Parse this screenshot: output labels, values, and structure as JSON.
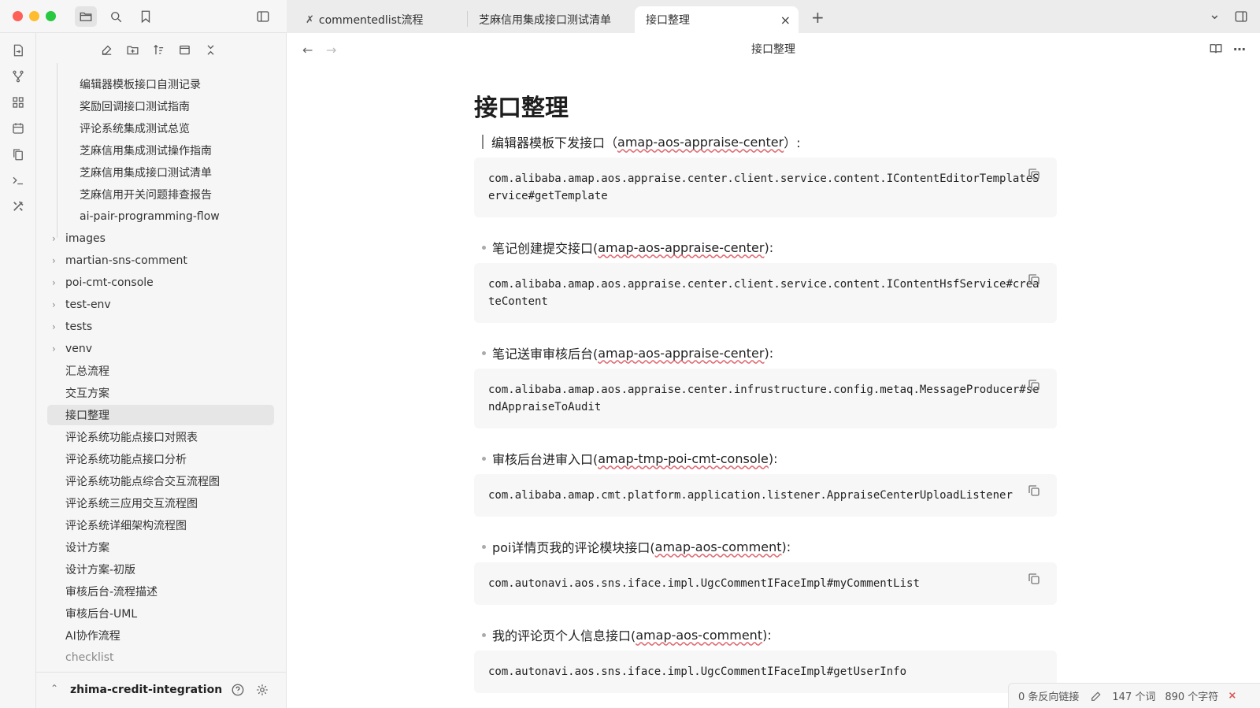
{
  "tabs": [
    {
      "label": "commentedlist流程",
      "icon": "tool-icon"
    },
    {
      "label": "芝麻信用集成接口测试清单"
    },
    {
      "label": "接口整理",
      "active": true
    }
  ],
  "tabbar": {
    "new_tab": "+",
    "close": "×",
    "more": "⌄"
  },
  "sidebar": {
    "tree": [
      {
        "label": "编辑器模板接口自测记录",
        "level": 2
      },
      {
        "label": "奖励回调接口测试指南",
        "level": 2
      },
      {
        "label": "评论系统集成测试总览",
        "level": 2
      },
      {
        "label": "芝麻信用集成测试操作指南",
        "level": 2
      },
      {
        "label": "芝麻信用集成接口测试清单",
        "level": 2
      },
      {
        "label": "芝麻信用开关问题排查报告",
        "level": 2
      },
      {
        "label": "ai-pair-programming-flow",
        "level": 2
      },
      {
        "label": "images",
        "level": 1,
        "folder": true
      },
      {
        "label": "martian-sns-comment",
        "level": 1,
        "folder": true
      },
      {
        "label": "poi-cmt-console",
        "level": 1,
        "folder": true
      },
      {
        "label": "test-env",
        "level": 1,
        "folder": true
      },
      {
        "label": "tests",
        "level": 1,
        "folder": true
      },
      {
        "label": "venv",
        "level": 1,
        "folder": true
      },
      {
        "label": "汇总流程",
        "level": 1
      },
      {
        "label": "交互方案",
        "level": 1
      },
      {
        "label": "接口整理",
        "level": 1,
        "active": true
      },
      {
        "label": "评论系统功能点接口对照表",
        "level": 1
      },
      {
        "label": "评论系统功能点接口分析",
        "level": 1
      },
      {
        "label": "评论系统功能点综合交互流程图",
        "level": 1
      },
      {
        "label": "评论系统三应用交互流程图",
        "level": 1
      },
      {
        "label": "评论系统详细架构流程图",
        "level": 1
      },
      {
        "label": "设计方案",
        "level": 1
      },
      {
        "label": "设计方案-初版",
        "level": 1
      },
      {
        "label": "审核后台-流程描述",
        "level": 1
      },
      {
        "label": "审核后台-UML",
        "level": 1
      },
      {
        "label": "AI协作流程",
        "level": 1
      },
      {
        "label": "checklist",
        "level": 1
      }
    ],
    "vault_name": "zhima-credit-integration",
    "folder_chevron": "›",
    "vault_chevron": "⌃"
  },
  "editor": {
    "back": "←",
    "forward": "→",
    "doc_title": "接口整理",
    "h1": "接口整理",
    "entries": [
      {
        "prefix": "编辑器模板下发接口（",
        "service": "amap-aos-appraise-center",
        "suffix": "）:",
        "code": "com.alibaba.amap.aos.appraise.center.client.service.content.IContentEditorTemplateService#getTemplate",
        "bar": true
      },
      {
        "prefix": "笔记创建提交接口(",
        "service": "amap-aos-appraise-center",
        "suffix": "):",
        "code": "com.alibaba.amap.aos.appraise.center.client.service.content.IContentHsfService#createContent"
      },
      {
        "prefix": "笔记送审审核后台(",
        "service": "amap-aos-appraise-center",
        "suffix": "):",
        "code": "com.alibaba.amap.aos.appraise.center.infrustructure.config.metaq.MessageProducer#sendAppraiseToAudit"
      },
      {
        "prefix": "审核后台进审入口(",
        "service": "amap-tmp-poi-cmt-console",
        "suffix": "):",
        "code": "com.alibaba.amap.cmt.platform.application.listener.AppraiseCenterUploadListener"
      },
      {
        "prefix": "poi详情页我的评论模块接口(",
        "service": "amap-aos-comment",
        "suffix": "):",
        "code": "com.autonavi.aos.sns.iface.impl.UgcCommentIFaceImpl#myCommentList"
      },
      {
        "prefix": "我的评论页个人信息接口(",
        "service": "amap-aos-comment",
        "suffix": "):",
        "code": "com.autonavi.aos.sns.iface.impl.UgcCommentIFaceImpl#getUserInfo"
      }
    ]
  },
  "status": {
    "backlinks": "0 条反向链接",
    "words": "147 个词",
    "chars": "890 个字符"
  }
}
